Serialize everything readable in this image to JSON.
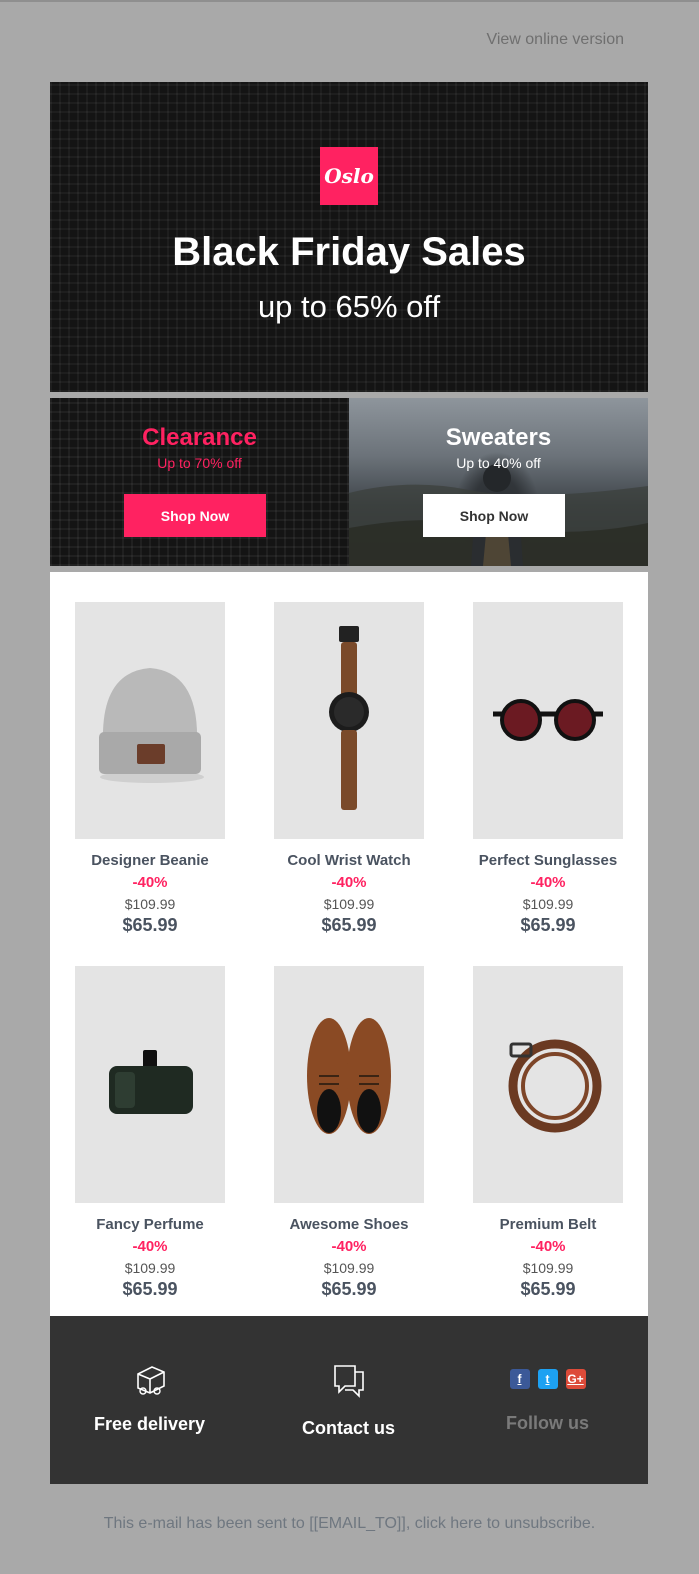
{
  "header": {
    "view_online": "View online version"
  },
  "hero": {
    "logo_text": "Oslo",
    "title": "Black Friday Sales",
    "subtitle": "up to 65% off",
    "logo_color": "#ff2261"
  },
  "promos": [
    {
      "title": "Clearance",
      "subtitle": "Up to 70% off",
      "button": "Shop Now",
      "accent": "#ff2261"
    },
    {
      "title": "Sweaters",
      "subtitle": "Up to 40% off",
      "button": "Shop Now"
    }
  ],
  "products": [
    {
      "name": "Designer Beanie",
      "discount": "-40%",
      "old_price": "$109.99",
      "price": "$65.99",
      "icon": "beanie"
    },
    {
      "name": "Cool Wrist Watch",
      "discount": "-40%",
      "old_price": "$109.99",
      "price": "$65.99",
      "icon": "watch"
    },
    {
      "name": "Perfect Sunglasses",
      "discount": "-40%",
      "old_price": "$109.99",
      "price": "$65.99",
      "icon": "sunglasses"
    },
    {
      "name": "Fancy Perfume",
      "discount": "-40%",
      "old_price": "$109.99",
      "price": "$65.99",
      "icon": "perfume"
    },
    {
      "name": "Awesome Shoes",
      "discount": "-40%",
      "old_price": "$109.99",
      "price": "$65.99",
      "icon": "shoes"
    },
    {
      "name": "Premium Belt",
      "discount": "-40%",
      "old_price": "$109.99",
      "price": "$65.99",
      "icon": "belt"
    }
  ],
  "footer": {
    "delivery": "Free delivery",
    "contact": "Contact us",
    "follow": "Follow us",
    "social": [
      {
        "icon": "facebook-icon",
        "glyph": "f",
        "color": "#3b5998"
      },
      {
        "icon": "twitter-icon",
        "glyph": "t",
        "color": "#1da1f2"
      },
      {
        "icon": "google-plus-icon",
        "glyph": "G+",
        "color": "#dd4b39"
      }
    ]
  },
  "unsubscribe": "This e-mail has been sent to [[EMAIL_TO]], click here to unsubscribe."
}
